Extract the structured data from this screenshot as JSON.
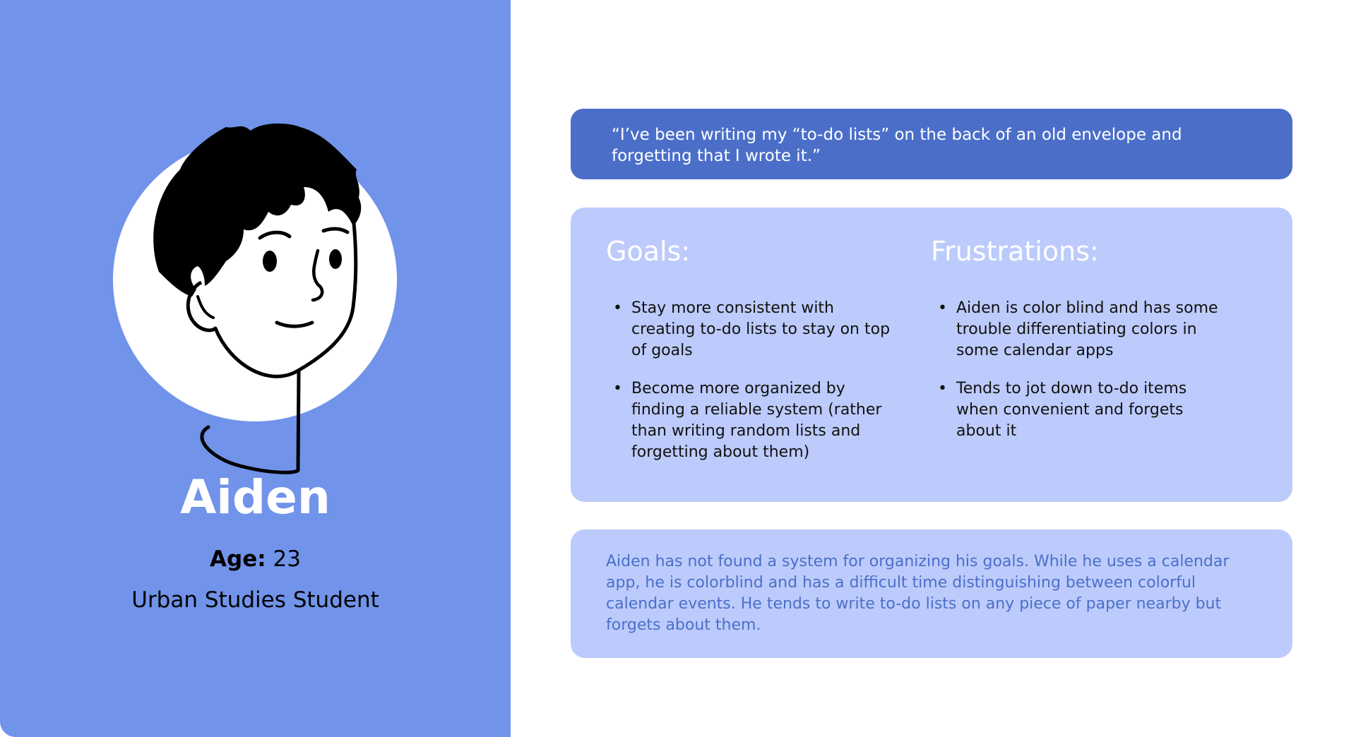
{
  "persona": {
    "name": "Aiden",
    "age_label": "Age:",
    "age_value": "23",
    "occupation": "Urban Studies Student"
  },
  "quote": "“I’ve been writing my “to-do lists” on the back of an old envelope and forgetting that I wrote it.”",
  "goals": {
    "heading": "Goals:",
    "items": [
      "Stay more consistent with creating to-do lists to stay on top of goals",
      "Become more organized by finding a reliable system (rather than writing random lists and forgetting about them)"
    ]
  },
  "frustrations": {
    "heading": "Frustrations:",
    "items": [
      "Aiden is color blind and has some trouble differentiating colors in some calendar apps",
      "Tends to jot down to-do items when convenient and forgets about it"
    ]
  },
  "summary": "Aiden has not found a system for organizing his goals. While he uses a calendar app, he is colorblind and has a difficult time distinguishing between colorful calendar events. He tends to write to-do lists on any piece of paper nearby but forgets about them.",
  "colors": {
    "left_panel": "#7193ea",
    "quote_bg": "#4b6fc9",
    "card_bg": "#bccbfb",
    "summary_text": "#4b6fc9"
  },
  "icons": {
    "avatar": "man-face-illustration",
    "bullet": "•"
  }
}
